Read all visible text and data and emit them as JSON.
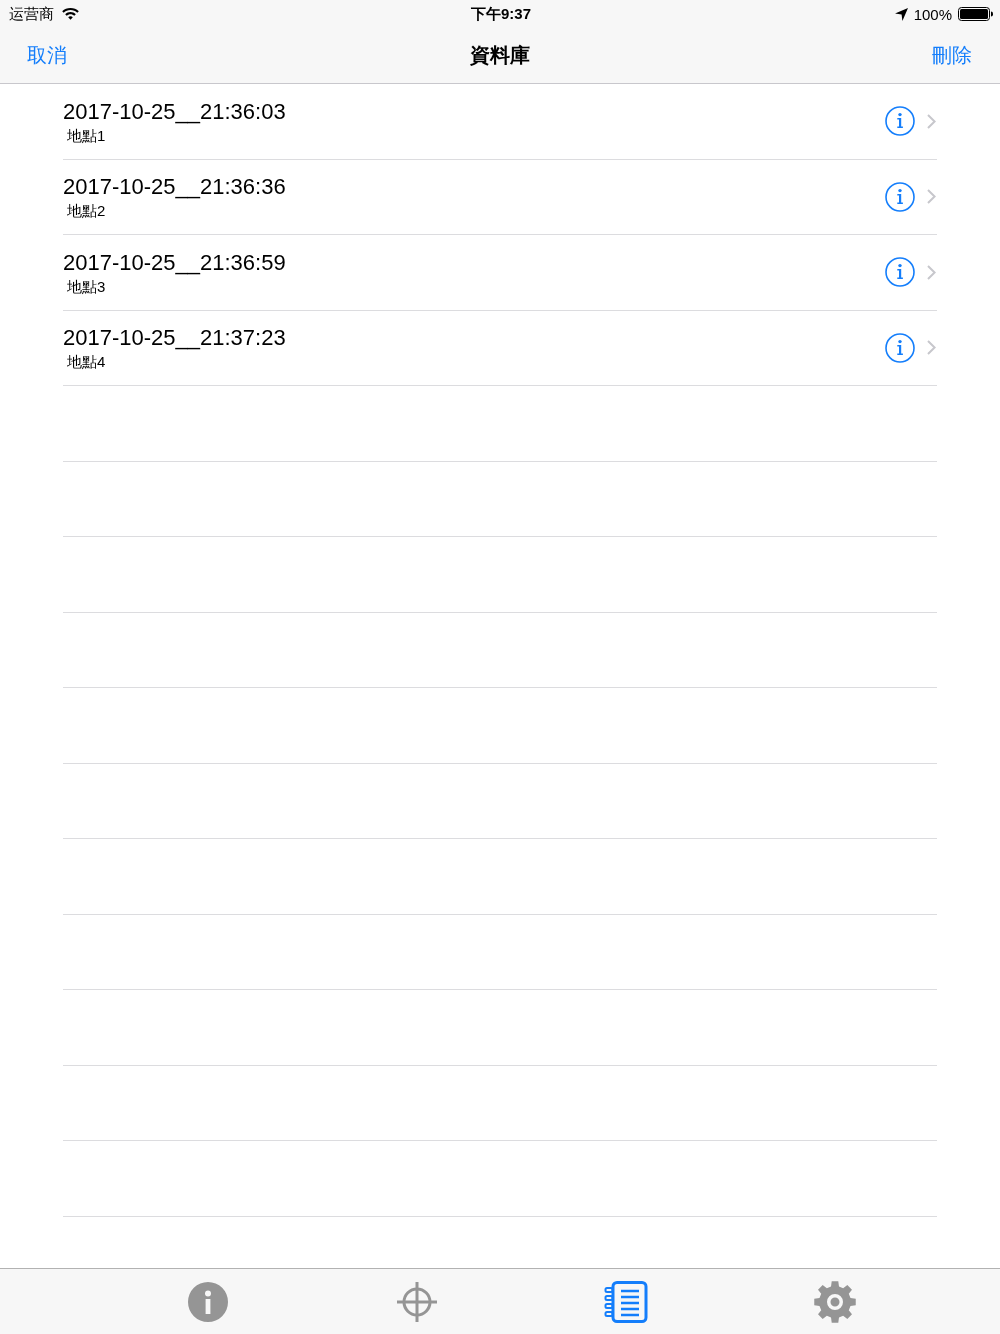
{
  "status_bar": {
    "carrier": "运营商",
    "time": "下午9:37",
    "battery": "100%"
  },
  "nav_bar": {
    "left_button": "取消",
    "title": "資料庫",
    "right_button": "刪除"
  },
  "rows": [
    {
      "title": "2017-10-25__21:36:03",
      "subtitle": "地點1"
    },
    {
      "title": "2017-10-25__21:36:36",
      "subtitle": "地點2"
    },
    {
      "title": "2017-10-25__21:36:59",
      "subtitle": "地點3"
    },
    {
      "title": "2017-10-25__21:37:23",
      "subtitle": "地點4"
    }
  ],
  "tab_bar": {
    "tabs": [
      {
        "kind": "info",
        "selected": false
      },
      {
        "kind": "locate",
        "selected": false
      },
      {
        "kind": "records",
        "selected": true
      },
      {
        "kind": "settings",
        "selected": false
      }
    ]
  }
}
